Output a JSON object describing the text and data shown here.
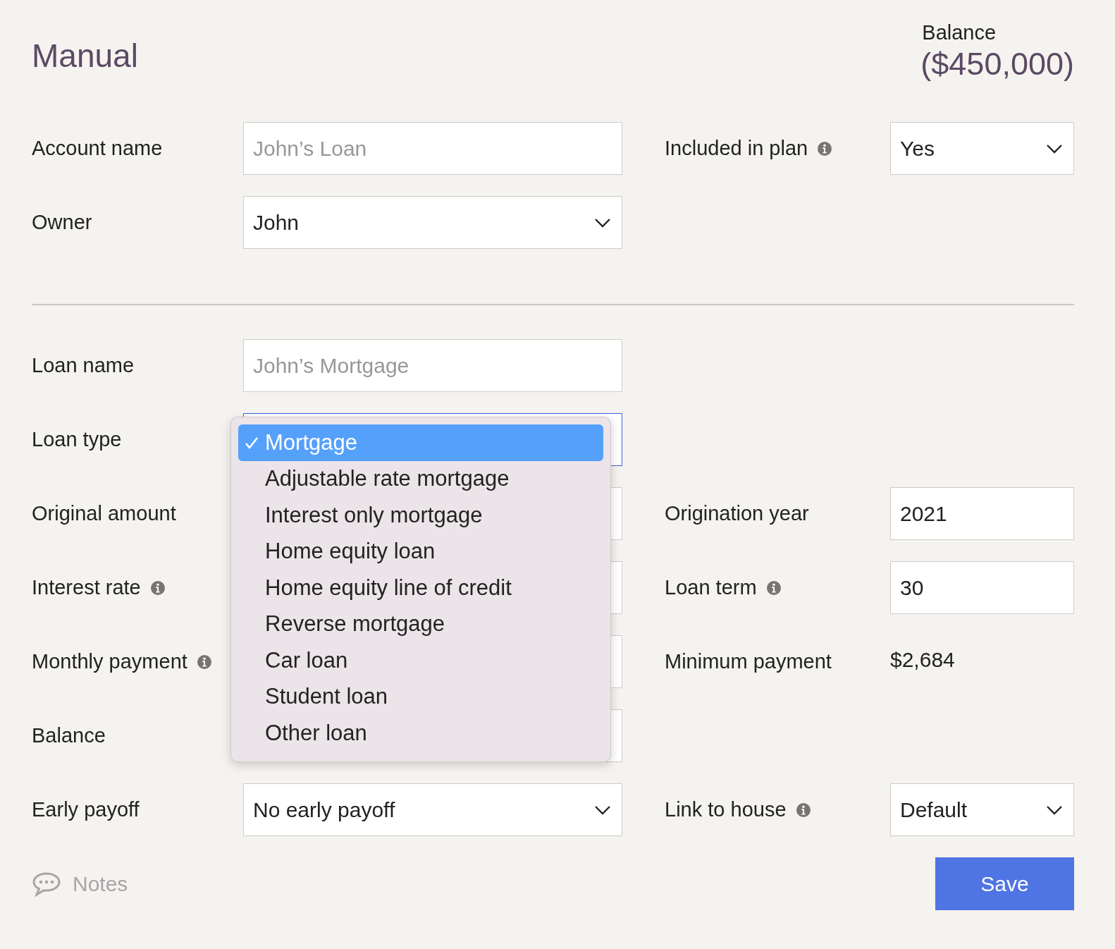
{
  "header": {
    "title": "Manual",
    "balance_label": "Balance",
    "balance_value": "($450,000)"
  },
  "account_rows": [
    {
      "left": {
        "label": "Account name",
        "field": {
          "kind": "input",
          "placeholder": "John’s Loan"
        }
      },
      "right": {
        "label": "Included in plan",
        "info": true,
        "field": {
          "kind": "select",
          "value": "Yes"
        }
      }
    },
    {
      "left": {
        "label": "Owner",
        "field": {
          "kind": "select",
          "value": "John"
        }
      }
    }
  ],
  "loan_rows": [
    {
      "left": {
        "label": "Loan name",
        "field": {
          "kind": "input",
          "placeholder": "John’s Mortgage"
        }
      }
    },
    {
      "left": {
        "label": "Loan type",
        "field": {
          "kind": "select",
          "focused": true,
          "menu_open": true
        }
      }
    },
    {
      "left": {
        "label": "Original amount",
        "field": {
          "kind": "input"
        }
      },
      "right": {
        "label": "Origination year",
        "field": {
          "kind": "input",
          "value": "2021"
        }
      }
    },
    {
      "left": {
        "label": "Interest rate",
        "info": true,
        "field": {
          "kind": "input"
        }
      },
      "right": {
        "label": "Loan term",
        "info": true,
        "field": {
          "kind": "input",
          "value": "30"
        }
      }
    },
    {
      "left": {
        "label": "Monthly payment",
        "info": true,
        "field": {
          "kind": "input"
        }
      },
      "right": {
        "label": "Minimum payment",
        "field": {
          "kind": "text",
          "value": "$2,684"
        }
      }
    },
    {
      "left": {
        "label": "Balance",
        "field": {
          "kind": "input"
        }
      }
    },
    {
      "left": {
        "label": "Early payoff",
        "field": {
          "kind": "select",
          "value": "No early payoff"
        }
      },
      "right": {
        "label": "Link to house",
        "info": true,
        "field": {
          "kind": "select",
          "value": "Default"
        }
      }
    }
  ],
  "dropdown": {
    "options": [
      {
        "label": "Mortgage",
        "selected": true
      },
      {
        "label": "Adjustable rate mortgage",
        "selected": false
      },
      {
        "label": "Interest only mortgage",
        "selected": false
      },
      {
        "label": "Home equity loan",
        "selected": false
      },
      {
        "label": "Home equity line of credit",
        "selected": false
      },
      {
        "label": "Reverse mortgage",
        "selected": false
      },
      {
        "label": "Car loan",
        "selected": false
      },
      {
        "label": "Student loan",
        "selected": false
      },
      {
        "label": "Other loan",
        "selected": false
      }
    ]
  },
  "notes": {
    "label": "Notes"
  },
  "save_button": "Save"
}
